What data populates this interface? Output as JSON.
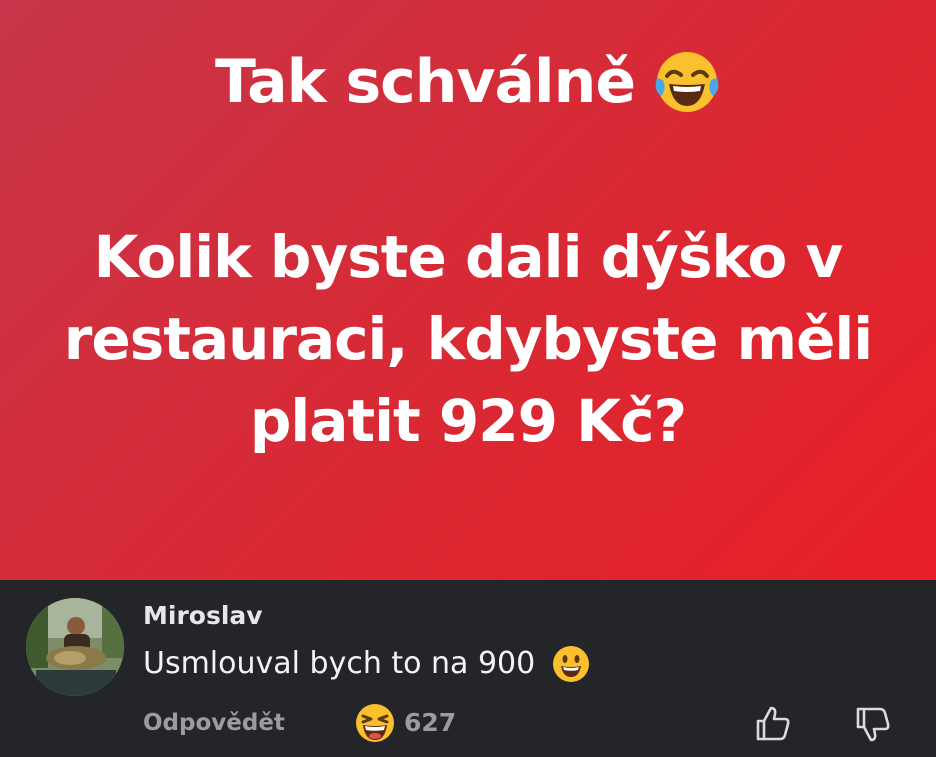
{
  "post": {
    "title": "Tak schválně",
    "question": "Kolik byste dali dýško v restauraci, kdybyste měli platit 929 Kč?",
    "title_emoji_icon": "face-with-tears-of-joy-icon"
  },
  "comment": {
    "author": "Miroslav",
    "text": "Usmlouval bych to na 900",
    "text_emoji_icon": "smiley-face-icon",
    "reply_label": "Odpovědět",
    "reaction_icon": "grinning-squinting-face-icon",
    "reaction_count": "627",
    "like_icon": "thumbs-up-icon",
    "dislike_icon": "thumbs-down-icon"
  },
  "colors": {
    "post_gradient_start": "#c7364a",
    "post_gradient_end": "#e81f26",
    "comment_background": "#232528",
    "muted_text": "#9a9ca1",
    "emoji_yellow": "#fbc02d"
  }
}
